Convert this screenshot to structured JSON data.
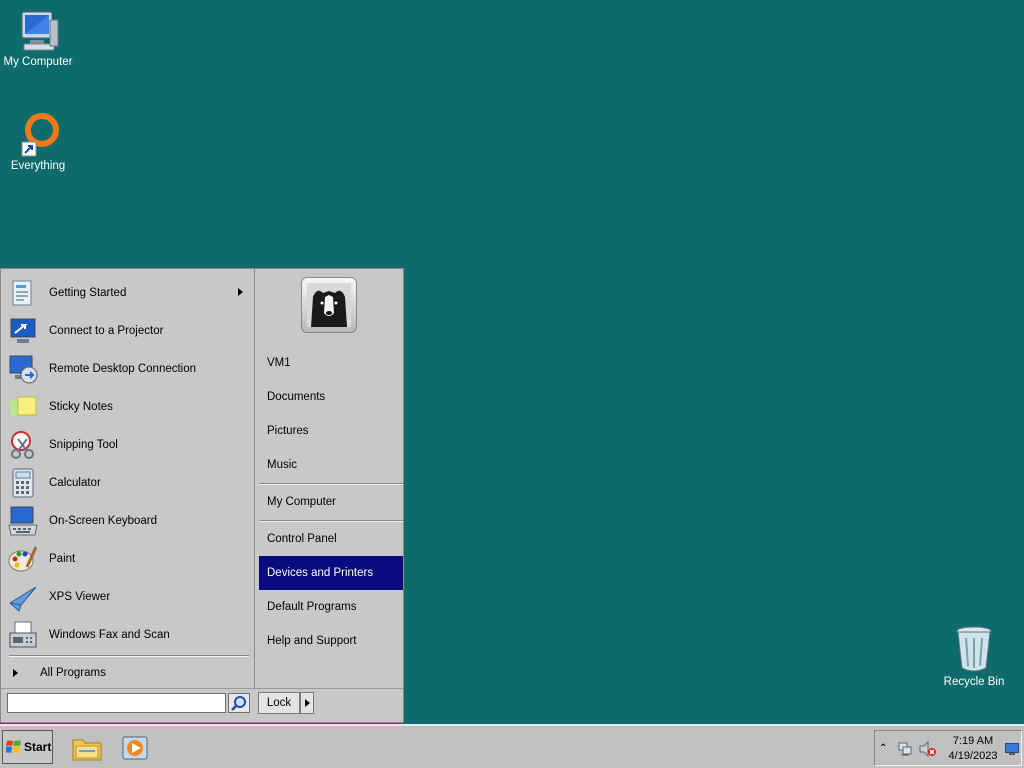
{
  "desktop": {
    "icons": [
      {
        "label": "My Computer",
        "icon": "computer-icon"
      },
      {
        "label": "Everything",
        "icon": "everything-icon"
      },
      {
        "label": "Recycle Bin",
        "icon": "recycle-bin-icon"
      }
    ]
  },
  "start_menu": {
    "programs": [
      {
        "label": "Getting Started",
        "icon": "getting-started-icon",
        "has_submenu": true
      },
      {
        "label": "Connect to a Projector",
        "icon": "projector-icon"
      },
      {
        "label": "Remote Desktop Connection",
        "icon": "remote-desktop-icon"
      },
      {
        "label": "Sticky Notes",
        "icon": "sticky-notes-icon"
      },
      {
        "label": "Snipping Tool",
        "icon": "snipping-tool-icon"
      },
      {
        "label": "Calculator",
        "icon": "calculator-icon"
      },
      {
        "label": "On-Screen Keyboard",
        "icon": "keyboard-icon"
      },
      {
        "label": "Paint",
        "icon": "paint-icon"
      },
      {
        "label": "XPS Viewer",
        "icon": "xps-viewer-icon"
      },
      {
        "label": "Windows Fax and Scan",
        "icon": "fax-icon"
      }
    ],
    "all_programs": "All Programs",
    "right_items": [
      {
        "label": "VM1"
      },
      {
        "label": "Documents"
      },
      {
        "label": "Pictures"
      },
      {
        "label": "Music"
      },
      {
        "label": "My Computer"
      },
      {
        "label": "Control Panel"
      },
      {
        "label": "Devices and Printers",
        "highlighted": true
      },
      {
        "label": "Default Programs"
      },
      {
        "label": "Help and Support"
      }
    ],
    "search": {
      "value": "",
      "placeholder": ""
    },
    "lock_label": "Lock"
  },
  "taskbar": {
    "start_label": "Start",
    "clock_time": "7:19 AM",
    "clock_date": "4/19/2023"
  },
  "colors": {
    "desktop": "#0e6b6b",
    "highlight": "#0a0a80"
  }
}
